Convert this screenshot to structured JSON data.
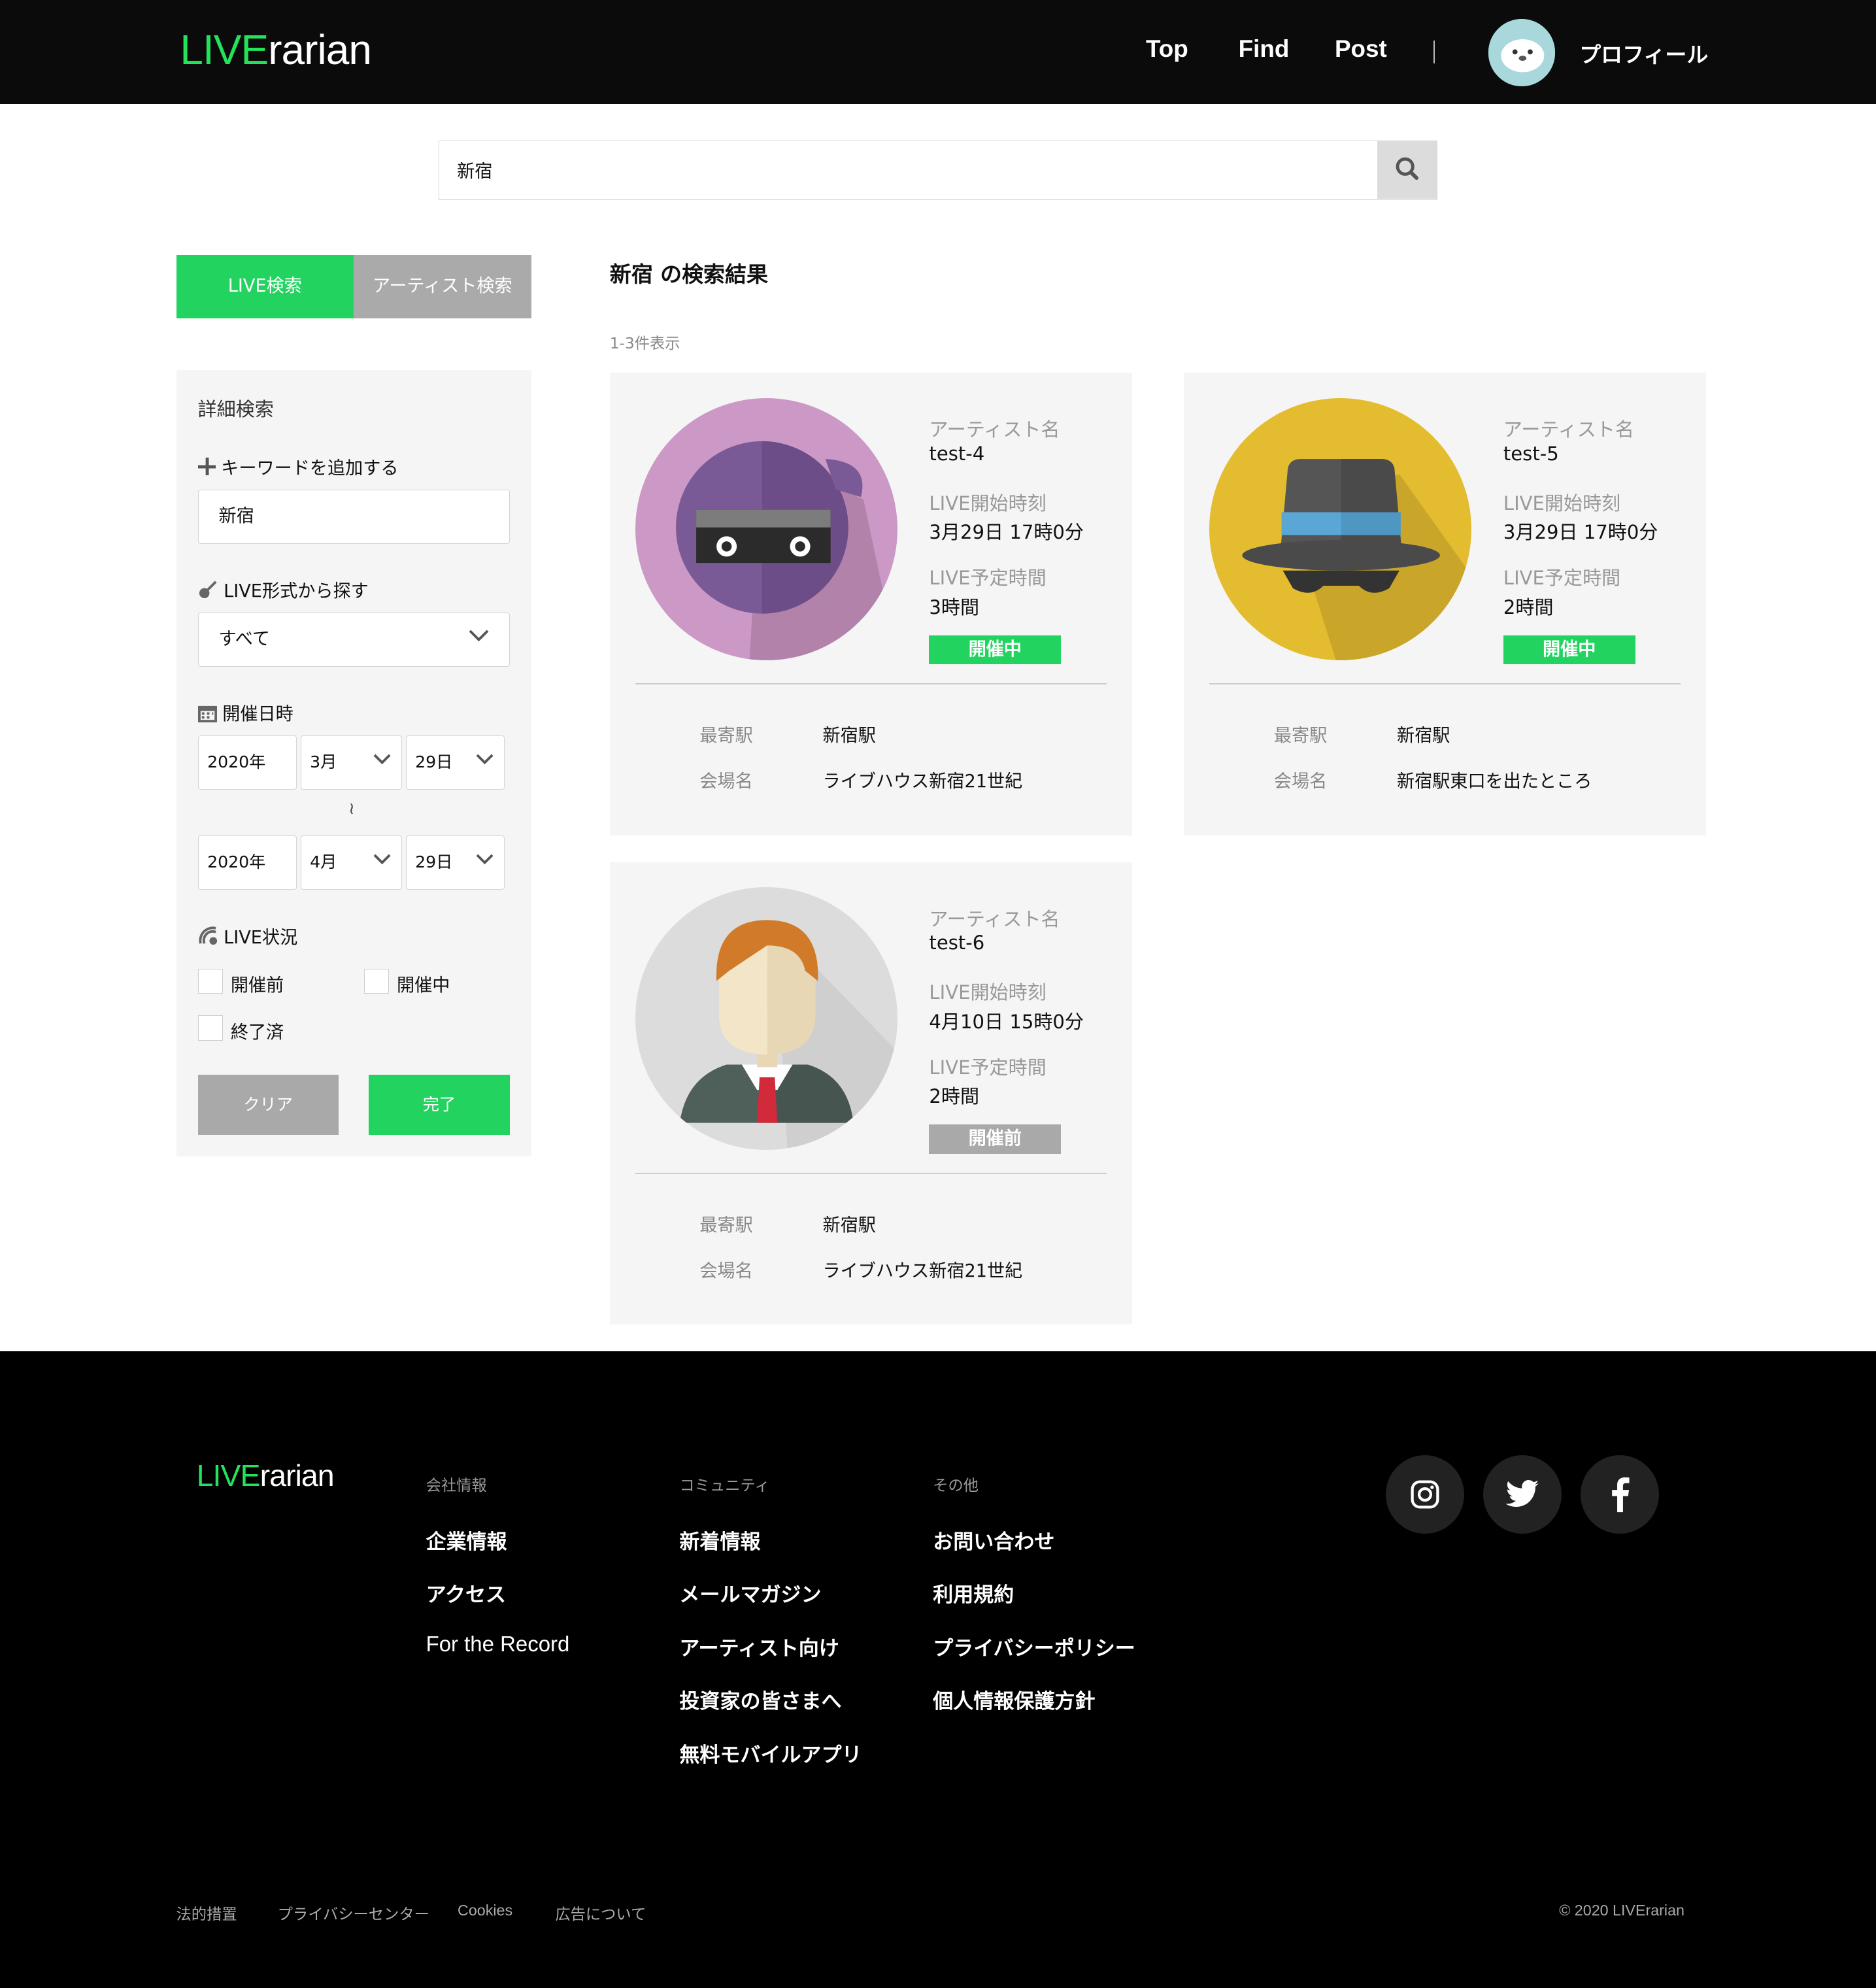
{
  "header": {
    "logo_accent": "LIVE",
    "logo_rest": "rarian",
    "nav": [
      "Top",
      "Find",
      "Post"
    ],
    "profile_label": "プロフィール"
  },
  "search": {
    "value": "新宿"
  },
  "tabs": {
    "live": "LIVE検索",
    "artist": "アーティスト検索"
  },
  "filter": {
    "title": "詳細検索",
    "keyword_label": "キーワードを追加する",
    "keyword_value": "新宿",
    "format_label": "LIVE形式から探す",
    "format_value": "すべて",
    "date_label": "開催日時",
    "from": {
      "year": "2020年",
      "month": "3月",
      "day": "29日"
    },
    "tilde": "≀",
    "to": {
      "year": "2020年",
      "month": "4月",
      "day": "29日"
    },
    "status_label": "LIVE状況",
    "status_options": [
      "開催前",
      "開催中",
      "終了済"
    ],
    "clear_label": "クリア",
    "done_label": "完了"
  },
  "results": {
    "title": "新宿 の検索結果",
    "count": "1-3件表示",
    "labels": {
      "artist": "アーティスト名",
      "start": "LIVE開始時刻",
      "duration": "LIVE予定時間",
      "station": "最寄駅",
      "venue": "会場名"
    },
    "cards": [
      {
        "artist": "test-4",
        "start": "3月29日 17時0分",
        "duration": "3時間",
        "status": "開催中",
        "station": "新宿駅",
        "venue": "ライブハウス新宿21世紀"
      },
      {
        "artist": "test-5",
        "start": "3月29日 17時0分",
        "duration": "2時間",
        "status": "開催中",
        "station": "新宿駅",
        "venue": "新宿駅東口を出たところ"
      },
      {
        "artist": "test-6",
        "start": "4月10日 15時0分",
        "duration": "2時間",
        "status": "開催前",
        "station": "新宿駅",
        "venue": "ライブハウス新宿21世紀"
      }
    ]
  },
  "footer": {
    "logo_accent": "LIVE",
    "logo_rest": "rarian",
    "columns": [
      {
        "heading": "会社情報",
        "items": [
          "企業情報",
          "アクセス",
          "For the Record"
        ]
      },
      {
        "heading": "コミュニティ",
        "items": [
          "新着情報",
          "メールマガジン",
          "アーティスト向け",
          "投資家の皆さまへ",
          "無料モバイルアプリ"
        ]
      },
      {
        "heading": "その他",
        "items": [
          "お問い合わせ",
          "利用規約",
          "プライバシーポリシー",
          "個人情報保護方針"
        ]
      }
    ],
    "social": [
      "instagram-icon",
      "twitter-icon",
      "facebook-icon"
    ],
    "bottom_links": [
      "法的措置",
      "プライバシーセンター",
      "Cookies",
      "広告について"
    ],
    "copyright": "© 2020 LIVErarian"
  },
  "colors": {
    "accent": "#22d35f",
    "logo_green": "#22e35a",
    "header_bg": "#0b0b0b",
    "panel_bg": "#f5f5f5",
    "inactive": "#a9a9a9"
  }
}
